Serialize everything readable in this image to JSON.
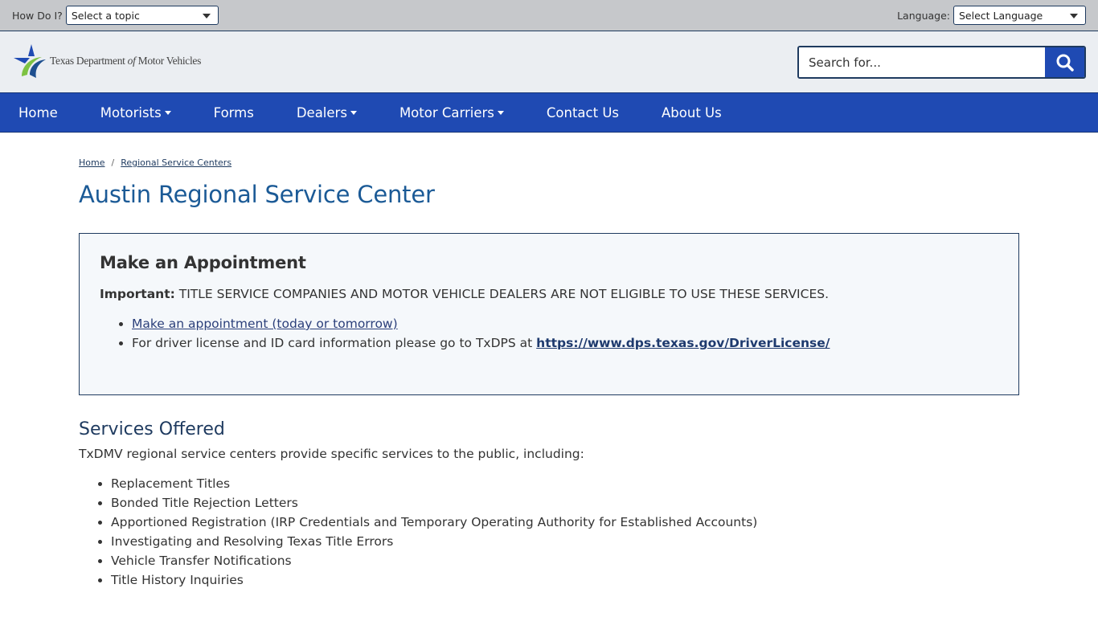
{
  "utility": {
    "how_label": "How Do I?",
    "topic_selected": "Select a topic",
    "language_label": "Language:",
    "language_selected": "Select Language"
  },
  "header": {
    "logo_text_1": "Texas Department ",
    "logo_text_of": "of",
    "logo_text_2": " Motor Vehicles",
    "logo_colors": {
      "blue": "#1f4ab3",
      "green": "#7dc242",
      "navy": "#1e4f8f"
    },
    "search_placeholder": "Search for..."
  },
  "nav": {
    "items": [
      {
        "label": "Home",
        "dropdown": false
      },
      {
        "label": "Motorists",
        "dropdown": true
      },
      {
        "label": "Forms",
        "dropdown": false
      },
      {
        "label": "Dealers",
        "dropdown": true
      },
      {
        "label": "Motor Carriers",
        "dropdown": true
      },
      {
        "label": "Contact Us",
        "dropdown": false
      },
      {
        "label": "About Us",
        "dropdown": false
      }
    ]
  },
  "breadcrumb": {
    "items": [
      "Home",
      "Regional Service Centers"
    ],
    "separator": "/"
  },
  "page": {
    "title": "Austin Regional Service Center"
  },
  "appointment": {
    "title": "Make an Appointment",
    "important_label": "Important:",
    "important_text": " TITLE SERVICE COMPANIES AND MOTOR VEHICLE DEALERS ARE NOT ELIGIBLE TO USE THESE SERVICES.",
    "link_label": "Make an appointment (today or tomorrow)",
    "dps_text": "For driver license and ID card information please go to TxDPS at ",
    "dps_link": "https://www.dps.texas.gov/DriverLicense/"
  },
  "services": {
    "title": "Services Offered",
    "intro": "TxDMV regional service centers provide specific services to the public, including:",
    "items": [
      "Replacement Titles",
      "Bonded Title Rejection Letters",
      "Apportioned Registration (IRP Credentials and Temporary Operating Authority for Established Accounts)",
      "Investigating and Resolving Texas Title Errors",
      "Vehicle Transfer Notifications",
      "Title History Inquiries"
    ]
  }
}
